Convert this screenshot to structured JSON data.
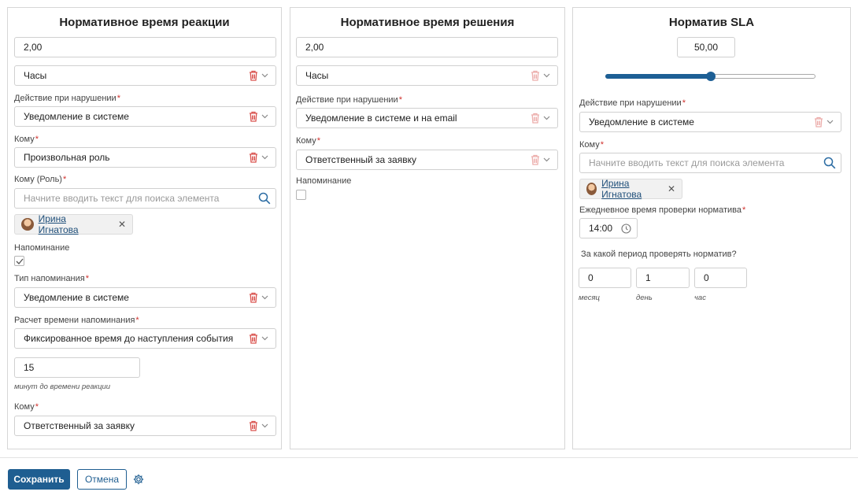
{
  "colors": {
    "accent": "#1f5e91",
    "required": "#d0312d",
    "trash": "#d9534f"
  },
  "panel_reaction": {
    "title": "Нормативное время реакции",
    "value": "2,00",
    "unit": "Часы",
    "violation_label": "Действие при нарушении",
    "violation_value": "Уведомление в системе",
    "to_label": "Кому",
    "to_value": "Произвольная роль",
    "to_role_label": "Кому (Роль)",
    "to_role_placeholder": "Начните вводить текст для поиска элемента",
    "chip_name": "Ирина Игнатова",
    "reminder_label": "Напоминание",
    "reminder_checked": true,
    "reminder_type_label": "Тип напоминания",
    "reminder_type_value": "Уведомление в системе",
    "reminder_calc_label": "Расчет времени напоминания",
    "reminder_calc_value": "Фиксированное время до наступления события",
    "minutes_value": "15",
    "minutes_hint": "минут до времени реакции",
    "to2_label": "Кому",
    "to2_value": "Ответственный за заявку"
  },
  "panel_solution": {
    "title": "Нормативное время решения",
    "value": "2,00",
    "unit": "Часы",
    "violation_label": "Действие при нарушении",
    "violation_value": "Уведомление в системе и на email",
    "to_label": "Кому",
    "to_value": "Ответственный за заявку",
    "reminder_label": "Напоминание",
    "reminder_checked": false
  },
  "panel_sla": {
    "title": "Норматив SLA",
    "value": "50,00",
    "slider_fraction": 0.5,
    "violation_label": "Действие при нарушении",
    "violation_value": "Уведомление в системе",
    "to_label": "Кому",
    "to_placeholder": "Начните вводить текст для поиска элемента",
    "chip_name": "Ирина Игнатова",
    "daily_check_label": "Ежедневное время проверки норматива",
    "daily_check_value": "14:00",
    "period_label": "За какой период проверять норматив?",
    "month_value": "0",
    "month_hint": "месяц",
    "day_value": "1",
    "day_hint": "день",
    "hour_value": "0",
    "hour_hint": "час"
  },
  "footer": {
    "save_label": "Сохранить",
    "cancel_label": "Отмена",
    "settings_icon": "gear-icon"
  }
}
